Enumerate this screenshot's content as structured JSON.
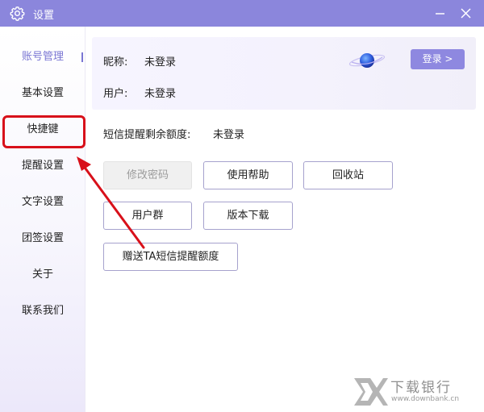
{
  "window": {
    "title": "设置",
    "titlebar_color": "#8b86dc",
    "accent": "#7a76d3"
  },
  "sidebar": {
    "items": [
      {
        "label": "账号管理",
        "active": true
      },
      {
        "label": "基本设置"
      },
      {
        "label": "快捷键",
        "highlighted": true
      },
      {
        "label": "提醒设置"
      },
      {
        "label": "文字设置"
      },
      {
        "label": "团签设置"
      },
      {
        "label": "关于"
      },
      {
        "label": "联系我们"
      }
    ]
  },
  "account": {
    "nickname_label": "昵称:",
    "nickname_value": "未登录",
    "user_label": "用户:",
    "user_value": "未登录",
    "login_button": "登录 >",
    "sms_quota_label": "短信提醒剩余额度:",
    "sms_quota_value": "未登录"
  },
  "actions": {
    "change_password": "修改密码",
    "help": "使用帮助",
    "recycle_bin": "回收站",
    "user_group": "用户群",
    "version_download": "版本下载",
    "gift_sms": "赠送TA短信提醒额度"
  },
  "watermark": {
    "name": "下载银行",
    "url": "www.downbank.cn"
  }
}
